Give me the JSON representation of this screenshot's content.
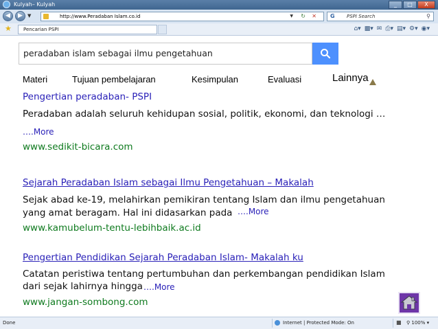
{
  "window": {
    "title": "Kulyah– Kulyah",
    "buttons": [
      "_",
      "□",
      "X"
    ]
  },
  "address_bar": {
    "url": "http://www.Peradaban Islam.co.id",
    "search_placeholder": "PSPI Search"
  },
  "tab": {
    "label": "Pencarian PSPI"
  },
  "search": {
    "query": "peradaban islam sebagai ilmu pengetahuan"
  },
  "menu": [
    {
      "label": "Materi"
    },
    {
      "label": "Tujuan pembelajaran"
    },
    {
      "label": "Kesimpulan"
    },
    {
      "label": "Evaluasi"
    },
    {
      "label": "Lainnya"
    }
  ],
  "results": [
    {
      "title": "Pengertian peradaban- PSPI",
      "lines": [
        "Peradaban adalah seluruh kehidupan  sosial, politik, ekonomi, dan teknologi …"
      ],
      "more": "….More",
      "url": "www.sedikit-bicara.com"
    },
    {
      "title": "Sejarah Peradaban Islam sebagai Ilmu Pengetahuan – Makalah",
      "lines": [
        "Sejak abad ke-19, melahirkan pemikiran tentang Islam dan ilmu pengetahuan",
        "yang amat beragam. Hal ini didasarkan pada"
      ],
      "more": "….More",
      "url": "www.kamubelum-tentu-lebihbaik.ac.id"
    },
    {
      "title": "Pengertian Pendidikan Sejarah Peradaban Islam- Makalah ku",
      "lines": [
        "Catatan peristiwa tentang pertumbuhan dan perkembangan pendidikan Islam",
        "dari sejak lahirnya hingga"
      ],
      "more": "….More",
      "url": "www.jangan-sombong.com"
    }
  ],
  "status": {
    "left": "Done",
    "zone": "Internet | Protected Mode: On",
    "zoom": "100%"
  },
  "colors": {
    "link": "#2a21b8",
    "url": "#0e7a1e",
    "search_button": "#4d90fe",
    "home_button": "#6e36a8"
  }
}
